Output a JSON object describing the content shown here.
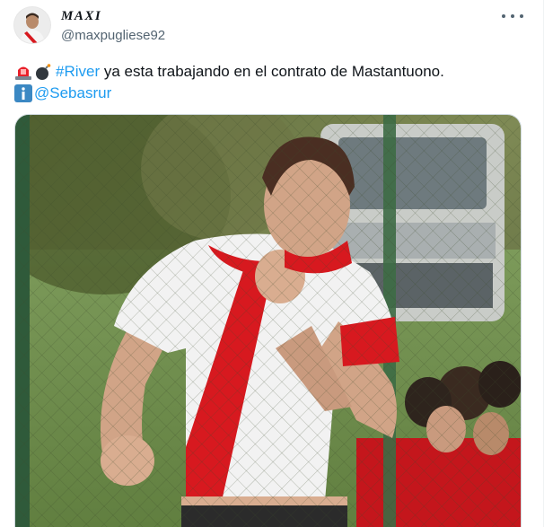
{
  "tweet": {
    "author_name": "MAXI",
    "author_handle": "@maxpugliese92",
    "more_icon": "ellipsis-icon",
    "text_line1": {
      "emoji_1": "rotating-light-icon",
      "emoji_2": "bomb-icon",
      "hashtag": "#River",
      "rest": " ya esta trabajando en el contrato de Mastantuono."
    },
    "text_line2": {
      "emoji": "information-icon",
      "mention": "@Sebasrur"
    },
    "photo": {
      "description_icon": "football-player-photo",
      "shirt_colors": {
        "white": "#f2f2f2",
        "red": "#d7191f"
      }
    }
  },
  "colors": {
    "link": "#1d9bf0",
    "secondary_text": "#536471",
    "primary_text": "#0f1419"
  }
}
